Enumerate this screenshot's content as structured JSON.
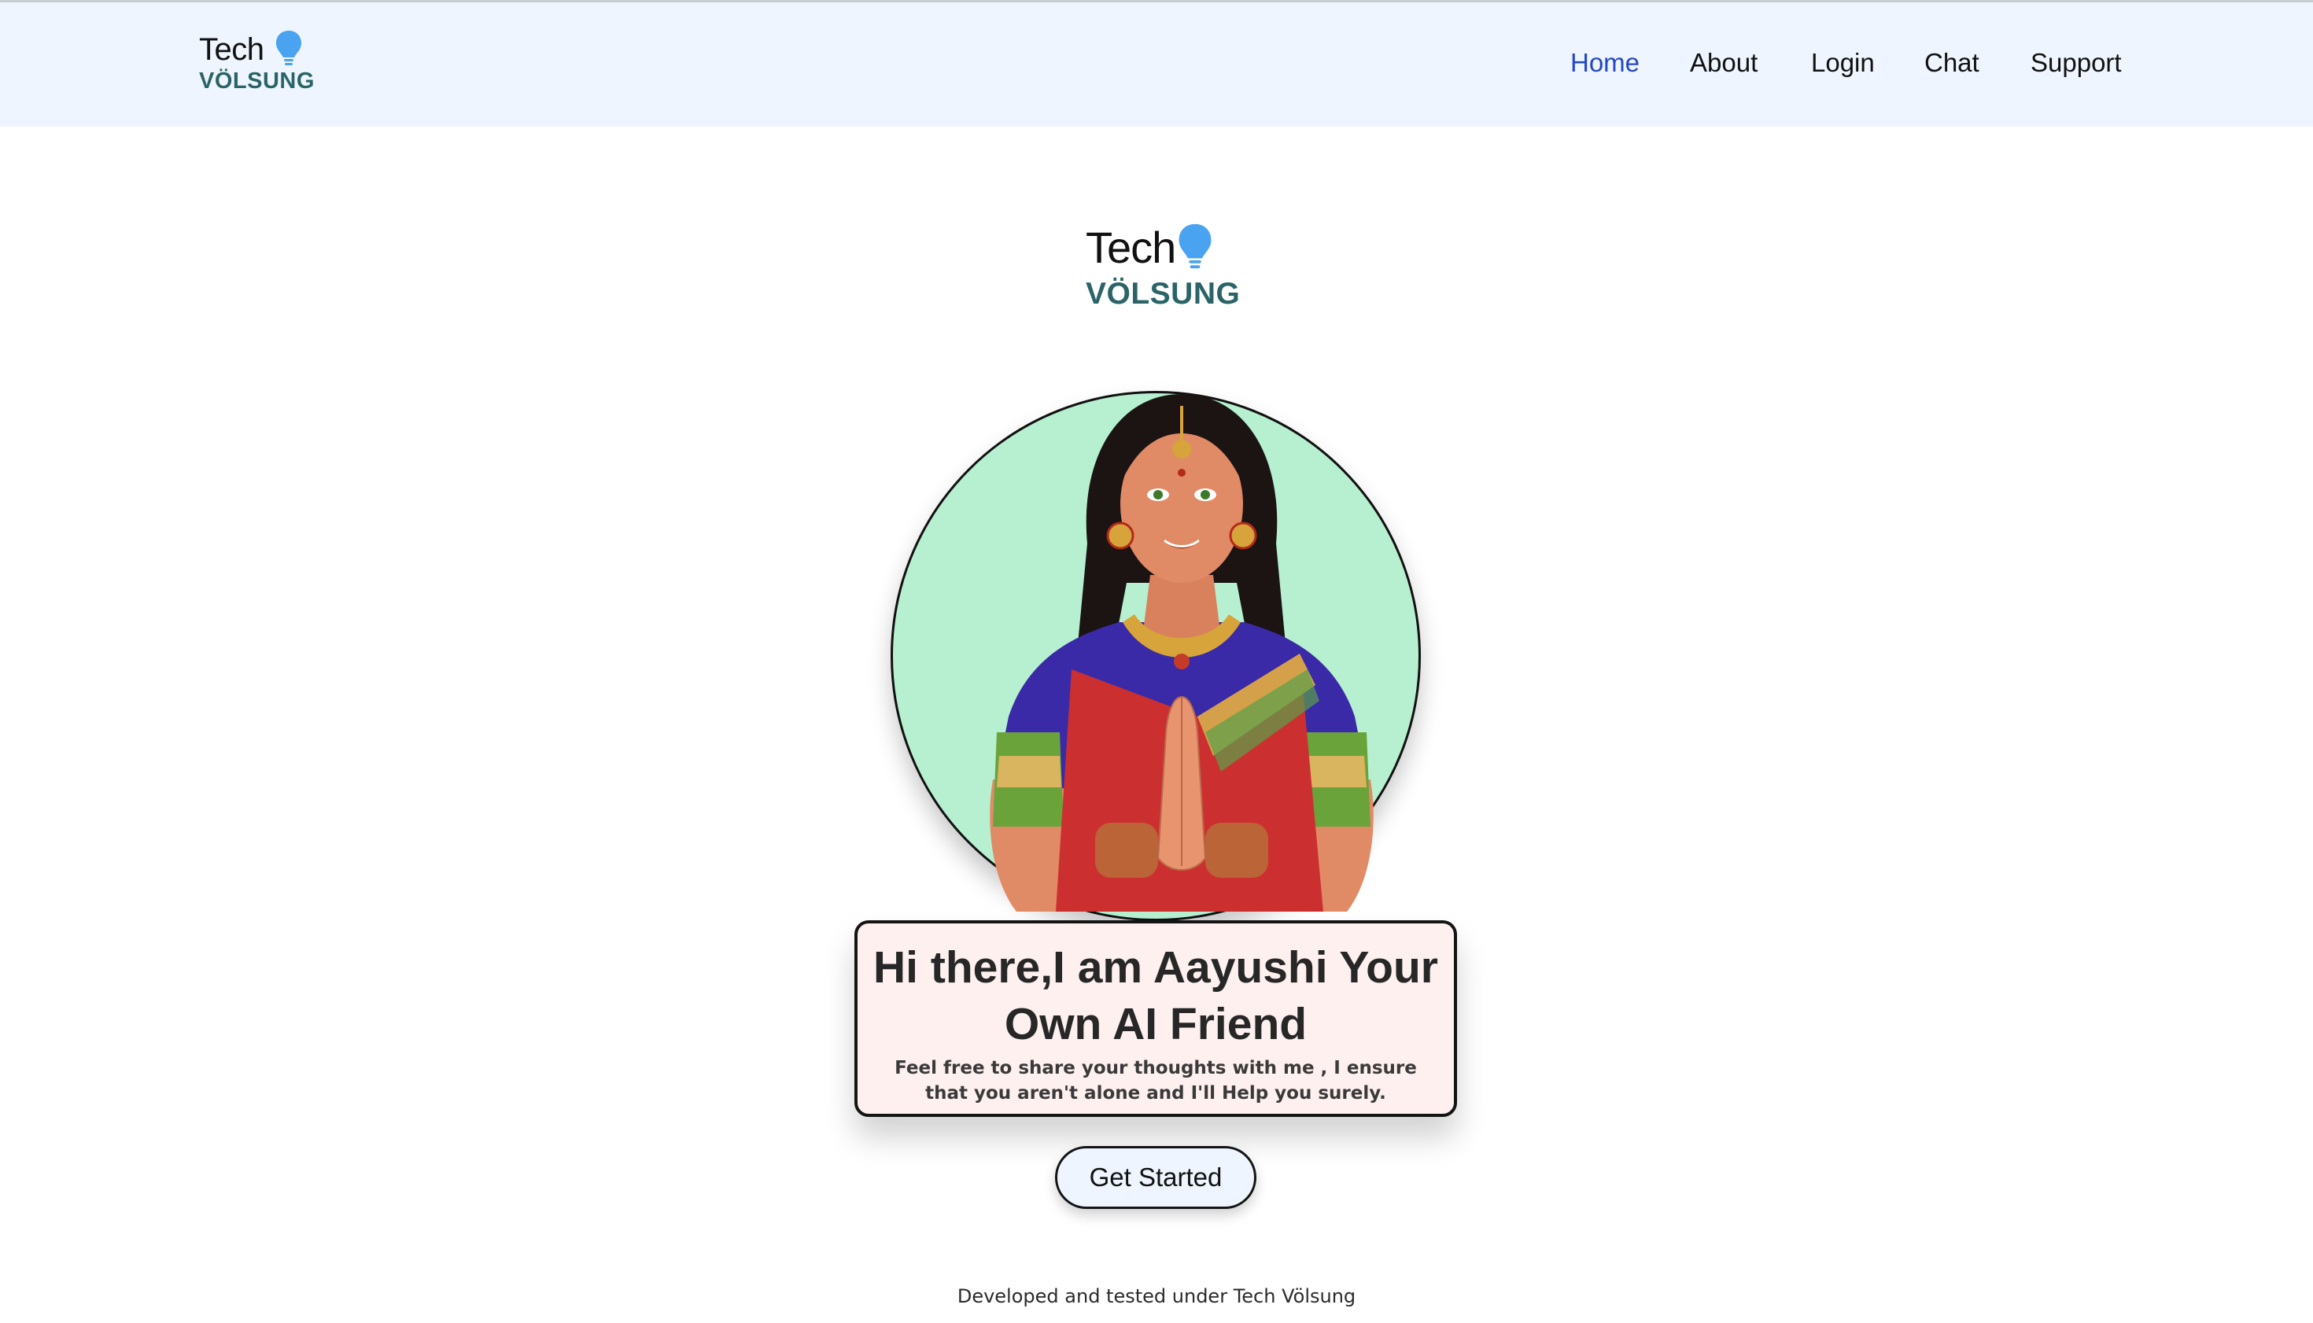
{
  "brand": {
    "tech": "Tech",
    "sub": "VÖLSUNG",
    "accent_color": "#4aa3f0",
    "sub_color": "#2a6468"
  },
  "nav": {
    "items": [
      {
        "label": "Home",
        "active": true
      },
      {
        "label": "About",
        "active": false
      },
      {
        "label": "Login",
        "active": false
      },
      {
        "label": "Chat",
        "active": false
      },
      {
        "label": "Support",
        "active": false
      }
    ],
    "active_color": "#2448c4"
  },
  "hero": {
    "title": "Hi there,I am Aayushi Your Own AI Friend",
    "subtitle": "Feel free to share your thoughts with me , I ensure that you aren't alone and I'll Help you surely.",
    "avatar_icon": "woman-namaste-avatar",
    "circle_color": "#b7f0d0",
    "card_color": "#fdf0ef"
  },
  "cta": {
    "label": "Get Started"
  },
  "footer": {
    "text": "Developed and tested under Tech Völsung"
  }
}
